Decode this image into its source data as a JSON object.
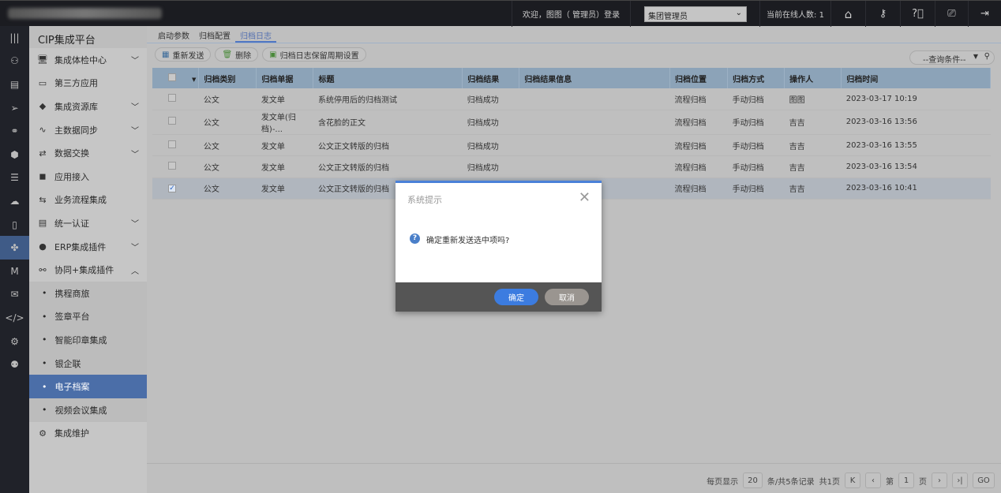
{
  "header": {
    "welcome": "欢迎，图图（     管理员）登录",
    "role": "集团管理员",
    "online": "当前在线人数: 1"
  },
  "sidebar": {
    "title": "CIP集成平台",
    "items": [
      {
        "label": "集成体检中心",
        "icon": "🖥",
        "arrow": "﹀"
      },
      {
        "label": "第三方应用",
        "icon": "▭",
        "arrow": ""
      },
      {
        "label": "集成资源库",
        "icon": "◆",
        "arrow": "﹀"
      },
      {
        "label": "主数据同步",
        "icon": "∿",
        "arrow": "﹀"
      },
      {
        "label": "数据交换",
        "icon": "⇄",
        "arrow": "﹀"
      },
      {
        "label": "应用接入",
        "icon": "◼",
        "arrow": ""
      },
      {
        "label": "业务流程集成",
        "icon": "⇆",
        "arrow": ""
      },
      {
        "label": "统一认证",
        "icon": "▤",
        "arrow": "﹀"
      },
      {
        "label": "ERP集成插件",
        "icon": "●",
        "arrow": "﹀"
      },
      {
        "label": "协同+集成插件",
        "icon": "⚯",
        "arrow": "︿"
      }
    ],
    "subitems": [
      "携程商旅",
      "签章平台",
      "智能印章集成",
      "银企联",
      "电子档案",
      "视频会议集成"
    ],
    "active": "电子档案",
    "footer": {
      "label": "集成维护",
      "icon": "⚙"
    }
  },
  "tabs": [
    "启动参数",
    "归档配置",
    "归档日志"
  ],
  "toolbar": {
    "resend": "重新发送",
    "delete": "删除",
    "retention": "归档日志保留周期设置",
    "query": "--查询条件--"
  },
  "table": {
    "headers": [
      "归档类别",
      "归档单据",
      "标题",
      "归档结果",
      "归档结果信息",
      "归档位置",
      "归档方式",
      "操作人",
      "归档时间"
    ],
    "rows": [
      {
        "checked": false,
        "cells": [
          "公文",
          "发文单",
          "系统停用后的归档测试",
          "归档成功",
          "",
          "流程归档",
          "手动归档",
          "图图",
          "2023-03-17 10:19"
        ]
      },
      {
        "checked": false,
        "cells": [
          "公文",
          "发文单(归档)-...",
          "含花脸的正文",
          "归档成功",
          "",
          "流程归档",
          "手动归档",
          "吉吉",
          "2023-03-16 13:56"
        ]
      },
      {
        "checked": false,
        "cells": [
          "公文",
          "发文单",
          "公文正文转版的归档",
          "归档成功",
          "",
          "流程归档",
          "手动归档",
          "吉吉",
          "2023-03-16 13:55"
        ]
      },
      {
        "checked": false,
        "cells": [
          "公文",
          "发文单",
          "公文正文转版的归档",
          "归档成功",
          "",
          "流程归档",
          "手动归档",
          "吉吉",
          "2023-03-16 13:54"
        ]
      },
      {
        "checked": true,
        "cells": [
          "公文",
          "发文单",
          "公文正文转版的归档",
          "",
          "",
          "流程归档",
          "手动归档",
          "吉吉",
          "2023-03-16 10:41"
        ]
      }
    ]
  },
  "pager": {
    "per_page_label": "每页显示",
    "per_page": "20",
    "summary": "条/共5条记录",
    "pages": "共1页",
    "page_prefix": "第",
    "page": "1",
    "page_suffix": "页",
    "go": "GO"
  },
  "dialog": {
    "title": "系统提示",
    "message": "确定重新发送选中项吗?",
    "ok": "确定",
    "cancel": "取消"
  }
}
